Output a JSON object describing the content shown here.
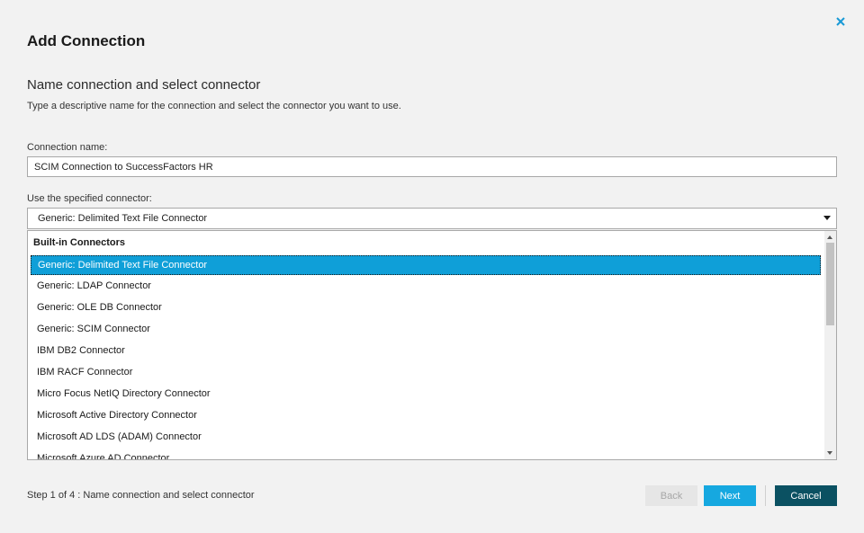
{
  "dialog": {
    "title": "Add Connection",
    "close_icon": "close-icon",
    "accent_color": "#16a8e0"
  },
  "section": {
    "heading": "Name connection and select connector",
    "description": "Type a descriptive name for the connection and select the connector you want to use."
  },
  "connection_name": {
    "label": "Connection name:",
    "value": "SCIM Connection to SuccessFactors HR"
  },
  "connector": {
    "label": "Use the specified connector:",
    "selected": "Generic: Delimited Text File Connector",
    "group_header": "Built-in Connectors",
    "options": [
      "Generic: Delimited Text File Connector",
      "Generic: LDAP Connector",
      "Generic: OLE DB Connector",
      "Generic: SCIM Connector",
      "IBM DB2 Connector",
      "IBM RACF Connector",
      "Micro Focus NetIQ Directory Connector",
      "Microsoft Active Directory Connector",
      "Microsoft AD LDS (ADAM) Connector",
      "Microsoft Azure AD Connector"
    ]
  },
  "footer": {
    "step_text": "Step 1 of 4 : Name connection and select connector",
    "back_label": "Back",
    "next_label": "Next",
    "cancel_label": "Cancel"
  }
}
